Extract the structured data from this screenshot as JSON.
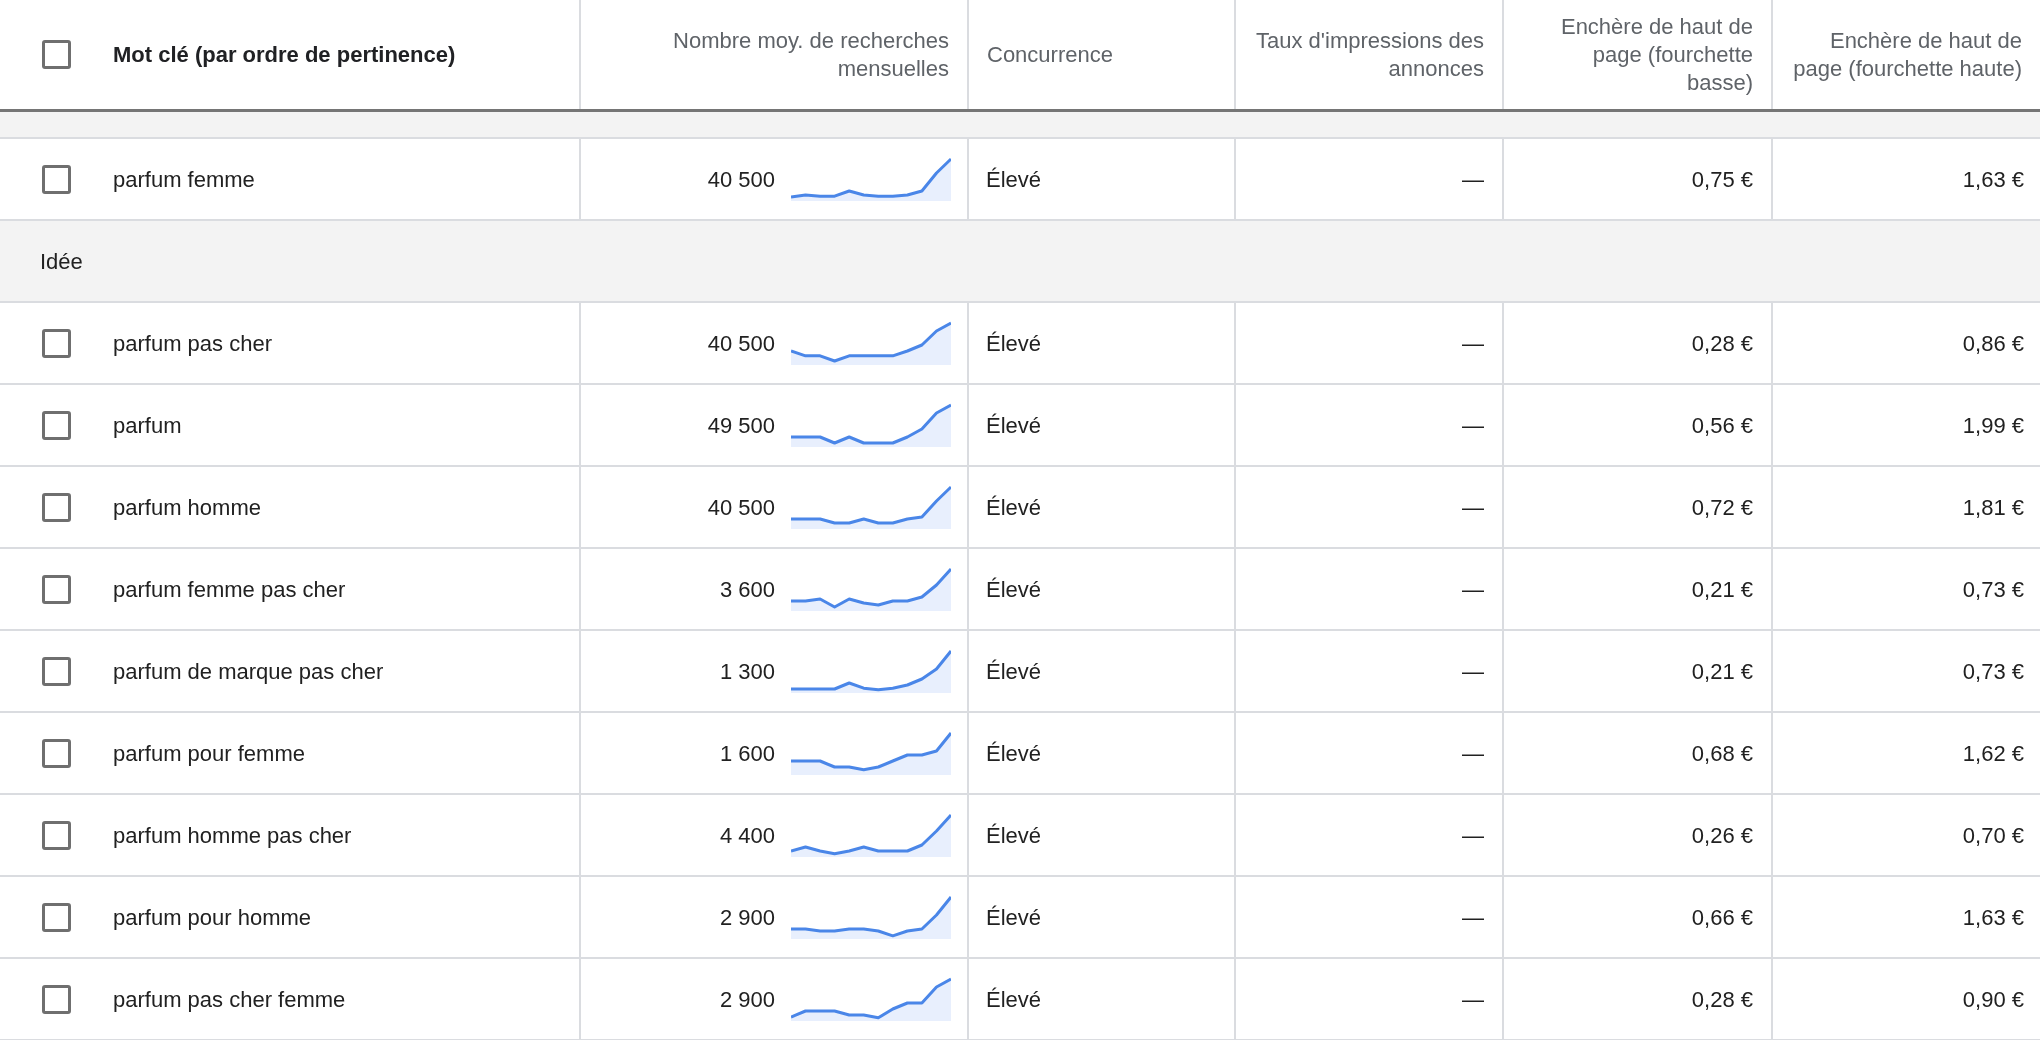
{
  "header": {
    "select_all": {
      "checked": false
    },
    "columns": [
      "Mot clé (par ordre de pertinence)",
      "Nombre moy. de recherches mensuelles",
      "Concurrence",
      "Taux d'impressions des annonces",
      "Enchère de haut de page (fourchette basse)",
      "Enchère de haut de page (fourchette haute)"
    ]
  },
  "sections": [
    {
      "rows": [
        {
          "checked": false,
          "keyword": "parfum femme",
          "searches": "40 500",
          "competition": "Élevé",
          "impression_share": "—",
          "bid_low": "0,75 €",
          "bid_high": "1,63 €"
        }
      ]
    },
    {
      "title": "Idée",
      "rows": [
        {
          "checked": false,
          "keyword": "parfum pas cher",
          "searches": "40 500",
          "competition": "Élevé",
          "impression_share": "—",
          "bid_low": "0,28 €",
          "bid_high": "0,86 €"
        },
        {
          "checked": false,
          "keyword": "parfum",
          "searches": "49 500",
          "competition": "Élevé",
          "impression_share": "—",
          "bid_low": "0,56 €",
          "bid_high": "1,99 €"
        },
        {
          "checked": false,
          "keyword": "parfum homme",
          "searches": "40 500",
          "competition": "Élevé",
          "impression_share": "—",
          "bid_low": "0,72 €",
          "bid_high": "1,81 €"
        },
        {
          "checked": false,
          "keyword": "parfum femme pas cher",
          "searches": "3 600",
          "competition": "Élevé",
          "impression_share": "—",
          "bid_low": "0,21 €",
          "bid_high": "0,73 €"
        },
        {
          "checked": false,
          "keyword": "parfum de marque pas cher",
          "searches": "1 300",
          "competition": "Élevé",
          "impression_share": "—",
          "bid_low": "0,21 €",
          "bid_high": "0,73 €"
        },
        {
          "checked": false,
          "keyword": "parfum pour femme",
          "searches": "1 600",
          "competition": "Élevé",
          "impression_share": "—",
          "bid_low": "0,68 €",
          "bid_high": "1,62 €"
        },
        {
          "checked": false,
          "keyword": "parfum homme pas cher",
          "searches": "4 400",
          "competition": "Élevé",
          "impression_share": "—",
          "bid_low": "0,26 €",
          "bid_high": "0,70 €"
        },
        {
          "checked": false,
          "keyword": "parfum pour homme",
          "searches": "2 900",
          "competition": "Élevé",
          "impression_share": "—",
          "bid_low": "0,66 €",
          "bid_high": "1,63 €"
        },
        {
          "checked": false,
          "keyword": "parfum pas cher femme",
          "searches": "2 900",
          "competition": "Élevé",
          "impression_share": "—",
          "bid_low": "0,28 €",
          "bid_high": "0,90 €"
        }
      ]
    }
  ]
}
